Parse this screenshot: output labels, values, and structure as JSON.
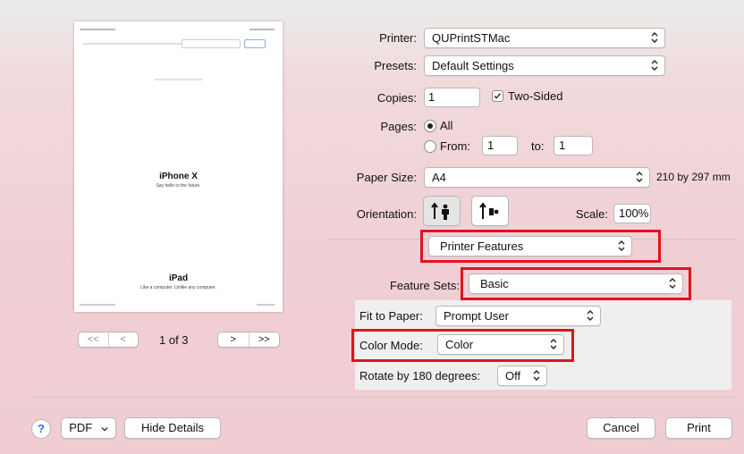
{
  "preview": {
    "page_heading_1": "iPhone X",
    "page_sub_1": "Say hello to the future.",
    "page_heading_2": "iPad",
    "page_sub_2": "Like a computer. Unlike any computer.",
    "page_indicator": "1 of 3",
    "first_label": "<<",
    "prev_label": "<",
    "next_label": ">",
    "last_label": ">>"
  },
  "printer": {
    "label": "Printer:",
    "value": "QUPrintSTMac"
  },
  "presets": {
    "label": "Presets:",
    "value": "Default Settings"
  },
  "copies": {
    "label": "Copies:",
    "value": "1",
    "two_sided_label": "Two-Sided",
    "two_sided_checked": true
  },
  "pages": {
    "label": "Pages:",
    "all_label": "All",
    "from_label": "From:",
    "from_value": "1",
    "to_label": "to:",
    "to_value": "1"
  },
  "paper_size": {
    "label": "Paper Size:",
    "value": "A4",
    "dimensions": "210 by 297 mm"
  },
  "orientation": {
    "label": "Orientation:"
  },
  "scale": {
    "label": "Scale:",
    "value": "100%"
  },
  "section_select": {
    "value": "Printer Features"
  },
  "feature_sets": {
    "label": "Feature Sets:",
    "value": "Basic"
  },
  "features": {
    "fit_to_paper_label": "Fit to Paper:",
    "fit_to_paper_value": "Prompt User",
    "color_mode_label": "Color Mode:",
    "color_mode_value": "Color",
    "rotate_label": "Rotate by 180 degrees:",
    "rotate_value": "Off"
  },
  "footer": {
    "help_label": "?",
    "pdf_label": "PDF",
    "hide_details_label": "Hide Details",
    "cancel_label": "Cancel",
    "print_label": "Print"
  },
  "colors": {
    "highlight": "#e0141e",
    "help_blue": "#1f7ae0"
  }
}
